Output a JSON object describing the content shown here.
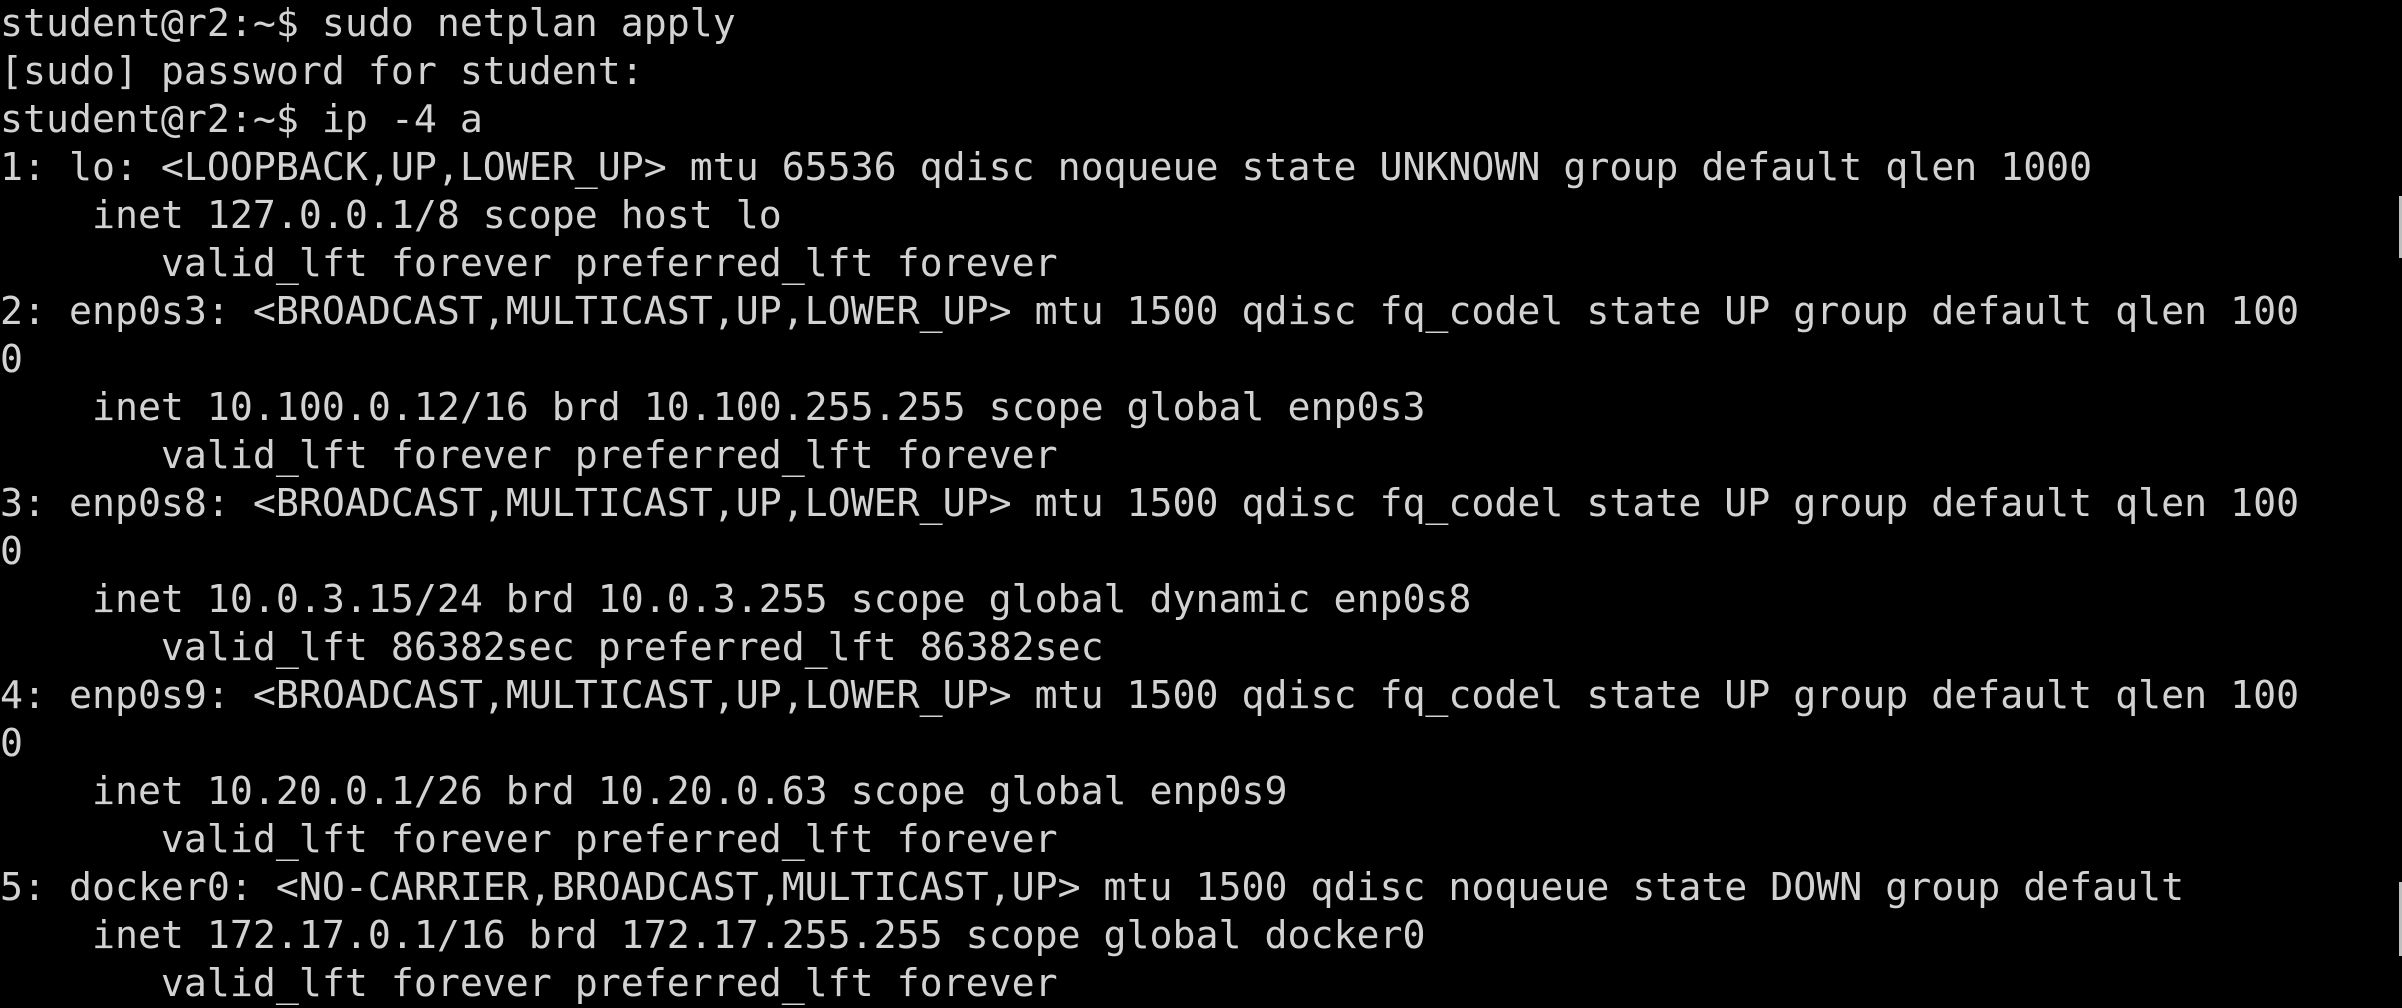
{
  "terminal": {
    "lines": [
      "student@r2:~$ sudo netplan apply",
      "[sudo] password for student:",
      "student@r2:~$ ip -4 a",
      "1: lo: <LOOPBACK,UP,LOWER_UP> mtu 65536 qdisc noqueue state UNKNOWN group default qlen 1000",
      "    inet 127.0.0.1/8 scope host lo",
      "       valid_lft forever preferred_lft forever",
      "2: enp0s3: <BROADCAST,MULTICAST,UP,LOWER_UP> mtu 1500 qdisc fq_codel state UP group default qlen 100",
      "0",
      "    inet 10.100.0.12/16 brd 10.100.255.255 scope global enp0s3",
      "       valid_lft forever preferred_lft forever",
      "3: enp0s8: <BROADCAST,MULTICAST,UP,LOWER_UP> mtu 1500 qdisc fq_codel state UP group default qlen 100",
      "0",
      "    inet 10.0.3.15/24 brd 10.0.3.255 scope global dynamic enp0s8",
      "       valid_lft 86382sec preferred_lft 86382sec",
      "4: enp0s9: <BROADCAST,MULTICAST,UP,LOWER_UP> mtu 1500 qdisc fq_codel state UP group default qlen 100",
      "0",
      "    inet 10.20.0.1/26 brd 10.20.0.63 scope global enp0s9",
      "       valid_lft forever preferred_lft forever",
      "5: docker0: <NO-CARRIER,BROADCAST,MULTICAST,UP> mtu 1500 qdisc noqueue state DOWN group default",
      "    inet 172.17.0.1/16 brd 172.17.255.255 scope global docker0",
      "       valid_lft forever preferred_lft forever"
    ]
  },
  "colors": {
    "background": "#000000",
    "foreground": "#d2d2d2"
  }
}
